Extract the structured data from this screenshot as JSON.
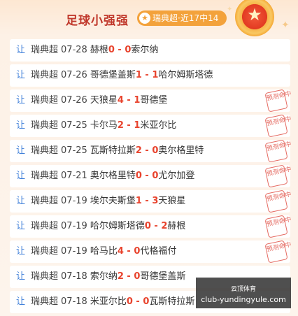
{
  "header": {
    "title": "足球小强强",
    "badge_label": "瑞典超·近17中14",
    "badge_icon": "star-icon"
  },
  "rows": [
    {
      "tag": "让",
      "league": "瑞典超",
      "date": "07-28",
      "home": "赫根",
      "home_score": "0",
      "away_score": "0",
      "away": "索尔纳",
      "stamp": ""
    },
    {
      "tag": "让",
      "league": "瑞典超",
      "date": "07-26",
      "home": "哥德堡盖斯",
      "home_score": "1",
      "away_score": "1",
      "away": "哈尔姆斯塔德",
      "stamp": ""
    },
    {
      "tag": "让",
      "league": "瑞典超",
      "date": "07-26",
      "home": "天狼星",
      "home_score": "4",
      "away_score": "1",
      "away": "哥德堡",
      "stamp": "预测命中"
    },
    {
      "tag": "让",
      "league": "瑞典超",
      "date": "07-25",
      "home": "卡尔马",
      "home_score": "2",
      "away_score": "1",
      "away": "米亚尔比",
      "stamp": "预测命中"
    },
    {
      "tag": "让",
      "league": "瑞典超",
      "date": "07-25",
      "home": "瓦斯特拉斯",
      "home_score": "2",
      "away_score": "0",
      "away": "奥尔格里特",
      "stamp": "预测命中"
    },
    {
      "tag": "让",
      "league": "瑞典超",
      "date": "07-21",
      "home": "奥尔格里特",
      "home_score": "0",
      "away_score": "0",
      "away": "尤尔加登",
      "stamp": "预测命中"
    },
    {
      "tag": "让",
      "league": "瑞典超",
      "date": "07-19",
      "home": "埃尔夫斯堡",
      "home_score": "1",
      "away_score": "3",
      "away": "天狼星",
      "stamp": "预测命中"
    },
    {
      "tag": "让",
      "league": "瑞典超",
      "date": "07-19",
      "home": "哈尔姆斯塔德",
      "home_score": "0",
      "away_score": "2",
      "away": "赫根",
      "stamp": "预测命中"
    },
    {
      "tag": "让",
      "league": "瑞典超",
      "date": "07-19",
      "home": "哈马比",
      "home_score": "4",
      "away_score": "0",
      "away": "代格福付",
      "stamp": "预测命中"
    },
    {
      "tag": "让",
      "league": "瑞典超",
      "date": "07-18",
      "home": "索尔纳",
      "home_score": "2",
      "away_score": "0",
      "away": "哥德堡盖斯",
      "stamp": ""
    },
    {
      "tag": "让",
      "league": "瑞典超",
      "date": "07-18",
      "home": "米亚尔比",
      "home_score": "0",
      "away_score": "0",
      "away": "瓦斯特拉斯",
      "stamp": ""
    }
  ],
  "watermark": {
    "line1": "云顶体育",
    "line2": "club-yundingyule.com"
  }
}
